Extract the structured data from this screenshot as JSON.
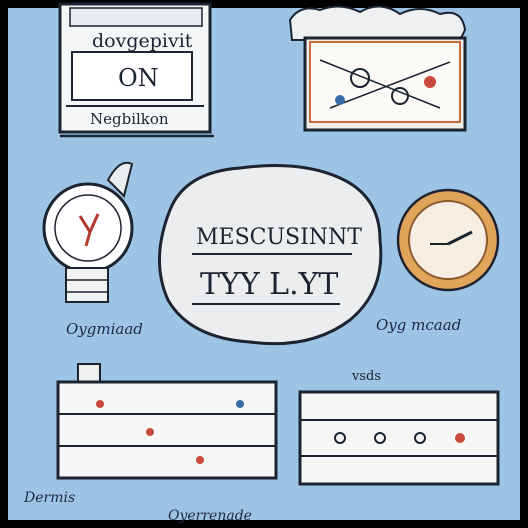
{
  "top_left_panel": {
    "header_text": "dovgepivit",
    "display_text": "ON",
    "caption": "Negbilkon"
  },
  "center_blob": {
    "line1": "MESCUSINNT",
    "line2": "TYY L.YT"
  },
  "left_bulb_caption": "Oygmiaad",
  "right_clock_caption": "Oyg mcaad",
  "bottom_left_caption": "Dermis",
  "bottom_center_caption": "Oyerrenade",
  "bottom_right_header": "vsds",
  "colors": {
    "background": "#9dc4e4",
    "frame": "#000000",
    "ink": "#1c2431",
    "clock_gold": "#e0a55a",
    "clock_face": "#f6efe2",
    "bulb_white": "#ffffff",
    "accent_red": "#c94a3c"
  }
}
